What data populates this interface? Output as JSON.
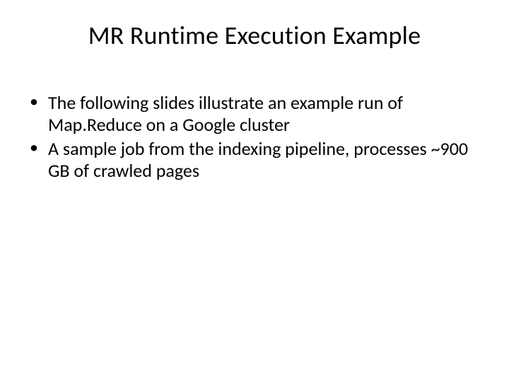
{
  "slide": {
    "title": "MR Runtime Execution Example",
    "bullets": [
      "The following slides illustrate an example run of Map.Reduce on a Google cluster",
      "A sample job from the indexing pipeline, processes ~900 GB of crawled pages"
    ]
  }
}
